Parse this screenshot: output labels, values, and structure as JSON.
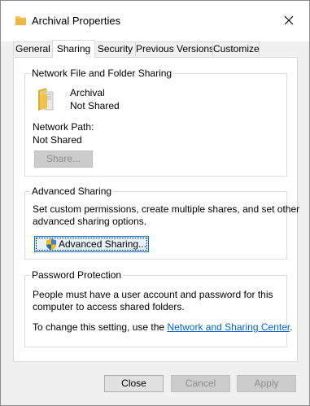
{
  "window": {
    "title": "Archival Properties",
    "close_icon": "close-icon"
  },
  "tabs": [
    {
      "label": "General"
    },
    {
      "label": "Sharing"
    },
    {
      "label": "Security"
    },
    {
      "label": "Previous Versions"
    },
    {
      "label": "Customize"
    }
  ],
  "network_sharing": {
    "group_title": "Network File and Folder Sharing",
    "folder_name": "Archival",
    "folder_status": "Not Shared",
    "network_path_label": "Network Path:",
    "network_path_value": "Not Shared",
    "share_button": "Share..."
  },
  "advanced_sharing": {
    "group_title": "Advanced Sharing",
    "description": "Set custom permissions, create multiple shares, and set other advanced sharing options.",
    "description_line1": "Set custom permissions, create multiple shares, and set other",
    "description_line2": "advanced sharing options.",
    "button": "Advanced Sharing..."
  },
  "password_protection": {
    "group_title": "Password Protection",
    "line1": "People must have a user account and password for this",
    "line2": "computer to access shared folders.",
    "change_prefix": "To change this setting, use the ",
    "link_text": "Network and Sharing Center",
    "change_suffix": "."
  },
  "footer": {
    "close": "Close",
    "cancel": "Cancel",
    "apply": "Apply"
  },
  "colors": {
    "accent": "#0078d7",
    "link": "#0066cc",
    "folder": "#e8b94a"
  }
}
